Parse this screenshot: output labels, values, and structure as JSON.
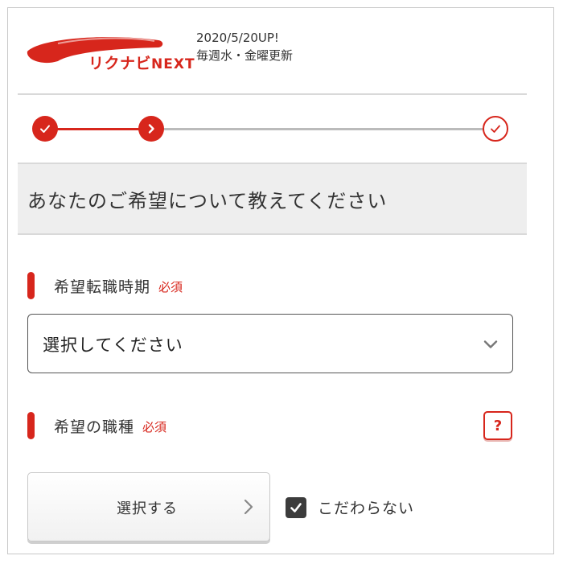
{
  "brand": {
    "logo_text": "リクナビ",
    "logo_next": "NEXT",
    "accent": "#d7261c"
  },
  "update": {
    "date": "2020/5/20UP!",
    "schedule": "毎週水・金曜更新"
  },
  "stepper": {
    "steps": [
      {
        "state": "done",
        "icon": "check-icon"
      },
      {
        "state": "current",
        "icon": "chevron-right-icon"
      },
      {
        "state": "todo",
        "icon": "check-outline-icon"
      }
    ]
  },
  "page": {
    "title": "あなたのご希望について教えてください"
  },
  "fields": {
    "timing": {
      "label": "希望転職時期",
      "required": "必須",
      "select_value": "選択してください"
    },
    "job_type": {
      "label": "希望の職種",
      "required": "必須",
      "help": "?",
      "button_label": "選択する",
      "no_preference_label": "こだわらない",
      "no_preference_checked": true
    }
  }
}
